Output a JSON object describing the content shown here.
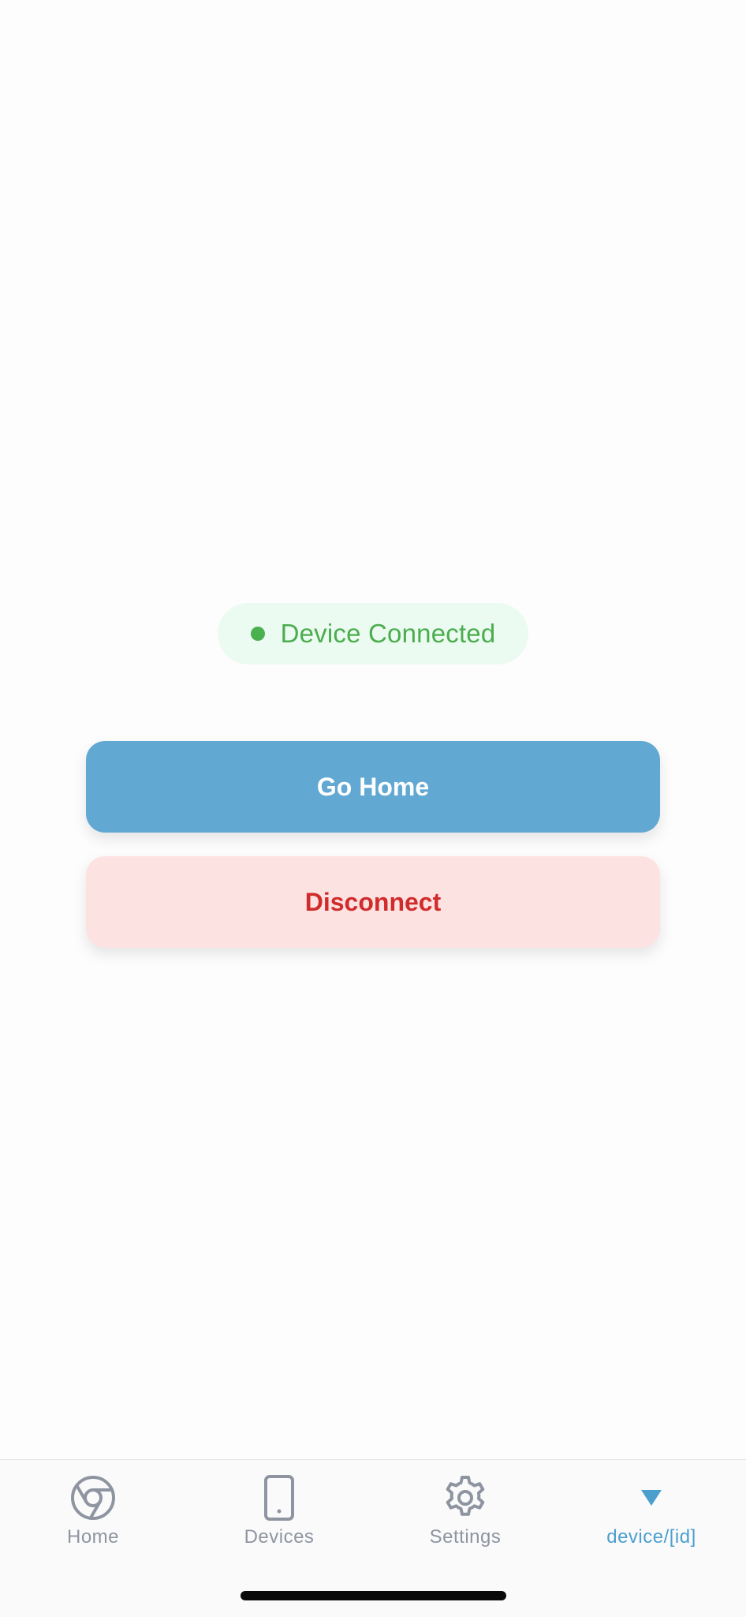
{
  "status": {
    "text": "Device Connected",
    "color": "#4bad4e"
  },
  "actions": {
    "go_home_label": "Go Home",
    "disconnect_label": "Disconnect"
  },
  "tabbar": {
    "items": [
      {
        "label": "Home",
        "icon": "chrome-icon",
        "active": false
      },
      {
        "label": "Devices",
        "icon": "phone-icon",
        "active": false
      },
      {
        "label": "Settings",
        "icon": "gear-icon",
        "active": false
      },
      {
        "label": "device/[id]",
        "icon": "triangle-down-icon",
        "active": true
      }
    ]
  },
  "colors": {
    "accent": "#61a8d3",
    "danger": "#d12c2c",
    "danger_bg": "#fde2e2",
    "success": "#4bb04f",
    "inactive_tab": "#8e95a1",
    "active_tab": "#4b9fcf"
  }
}
